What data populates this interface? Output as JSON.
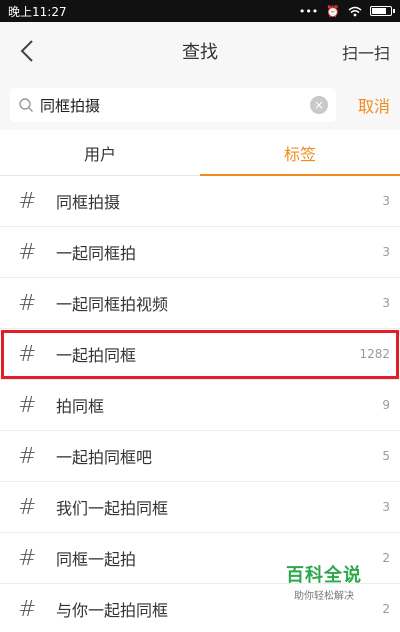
{
  "status_bar": {
    "time": "晚上11:27"
  },
  "header": {
    "title": "查找",
    "scan_label": "扫一扫"
  },
  "search": {
    "value": "同框拍摄",
    "cancel_label": "取消"
  },
  "tabs": [
    {
      "label": "用户",
      "active": false
    },
    {
      "label": "标签",
      "active": true
    }
  ],
  "results": [
    {
      "tag": "同框拍摄",
      "count": "3"
    },
    {
      "tag": "一起同框拍",
      "count": "3"
    },
    {
      "tag": "一起同框拍视频",
      "count": "3"
    },
    {
      "tag": "一起拍同框",
      "count": "1282",
      "highlighted": true
    },
    {
      "tag": "拍同框",
      "count": "9"
    },
    {
      "tag": "一起拍同框吧",
      "count": "5"
    },
    {
      "tag": "我们一起拍同框",
      "count": "3"
    },
    {
      "tag": "同框一起拍",
      "count": "2"
    },
    {
      "tag": "与你一起拍同框",
      "count": "2"
    }
  ],
  "hash_symbol": "#",
  "watermark": {
    "title": "百科全说",
    "subtitle": "助你轻松解决"
  },
  "colors": {
    "accent": "#f08c1e",
    "highlight": "#e21e26",
    "watermark": "#2aa84a"
  }
}
